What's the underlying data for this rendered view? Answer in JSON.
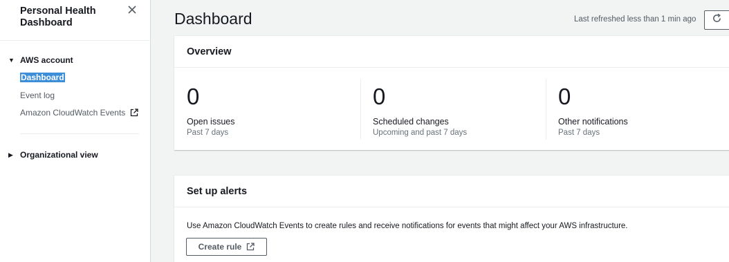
{
  "sidebar": {
    "title": "Personal Health Dashboard",
    "sections": [
      {
        "label": "AWS account",
        "items": [
          {
            "label": "Dashboard"
          },
          {
            "label": "Event log"
          },
          {
            "label": "Amazon CloudWatch Events"
          }
        ]
      },
      {
        "label": "Organizational view"
      }
    ]
  },
  "header": {
    "title": "Dashboard",
    "refresh_text": "Last refreshed less than 1 min ago"
  },
  "overview": {
    "title": "Overview",
    "stats": [
      {
        "value": "0",
        "label": "Open issues",
        "sub": "Past 7 days"
      },
      {
        "value": "0",
        "label": "Scheduled changes",
        "sub": "Upcoming and past 7 days"
      },
      {
        "value": "0",
        "label": "Other notifications",
        "sub": "Past 7 days"
      }
    ]
  },
  "alerts": {
    "title": "Set up alerts",
    "description": "Use Amazon CloudWatch Events to create rules and receive notifications for events that might affect your AWS infrastructure.",
    "button_label": "Create rule"
  },
  "colors": {
    "selection": "#3d8ed8",
    "text": "#16191f",
    "muted": "#687078"
  }
}
